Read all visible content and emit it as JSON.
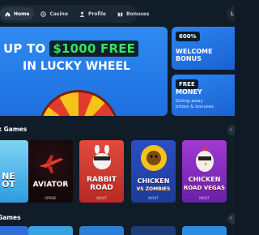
{
  "nav": {
    "items": [
      {
        "label": "Home",
        "icon": "home-icon",
        "active": true
      },
      {
        "label": "Casino",
        "icon": "casino-icon",
        "active": false
      },
      {
        "label": "Profile",
        "icon": "profile-icon",
        "active": false
      },
      {
        "label": "Bonuses",
        "icon": "gift-icon",
        "active": false
      }
    ],
    "login_label": "L"
  },
  "hero": {
    "line1_prefix": "UP TO",
    "amount": "$1000 FREE",
    "line2": "IN LUCKY WHEEL",
    "accent_color": "#39e35a"
  },
  "promos": [
    {
      "badge": "600%",
      "title_lines": [
        "WELCOME",
        "BONUS"
      ],
      "subtitle_lines": []
    },
    {
      "badge": "FREE",
      "title_lines": [
        "MONEY"
      ],
      "subtitle_lines": [
        "Giving away",
        "prizes & bonuses"
      ]
    }
  ],
  "sections": {
    "quick_games": "k Games",
    "live_games": "Games",
    "arrow_icon": "‹"
  },
  "games": [
    {
      "title_lines": [
        "NE",
        "OT"
      ],
      "provider": ""
    },
    {
      "title_lines": [
        "AVIATOR"
      ],
      "provider": "SPRIBE"
    },
    {
      "title_lines": [
        "RABBIT",
        "ROAD"
      ],
      "provider": "INOUT"
    },
    {
      "title_lines": [
        "CHICKEN",
        "VS ZOMBIES"
      ],
      "provider": "INOUT"
    },
    {
      "title_lines": [
        "CHICKEN",
        "ROAD VEGAS"
      ],
      "provider": "INOUT"
    }
  ]
}
